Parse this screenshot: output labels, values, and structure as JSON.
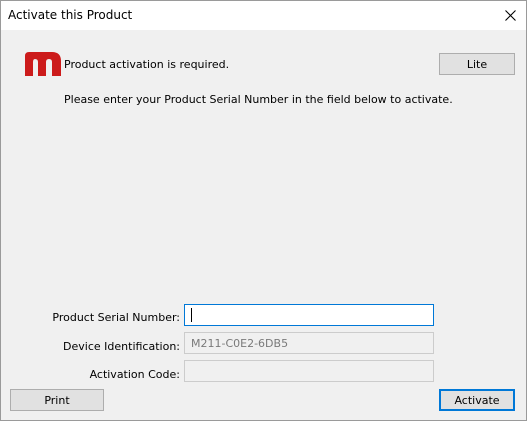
{
  "window": {
    "title": "Activate this Product",
    "close_glyph": "close-icon"
  },
  "header": {
    "logo_icon": "m-logo-icon",
    "logo_color": "#cc1b1b",
    "status_message": "Product activation is required.",
    "instruction": "Please enter your Product Serial Number in the field below to activate.",
    "lite_label": "Lite"
  },
  "form": {
    "serial": {
      "label": "Product Serial Number:",
      "value": ""
    },
    "device": {
      "label": "Device Identification:",
      "value": "M211-C0E2-6DB5"
    },
    "code": {
      "label": "Activation Code:",
      "value": ""
    }
  },
  "footer": {
    "print_label": "Print",
    "activate_label": "Activate",
    "focus_color": "#0078d7"
  }
}
